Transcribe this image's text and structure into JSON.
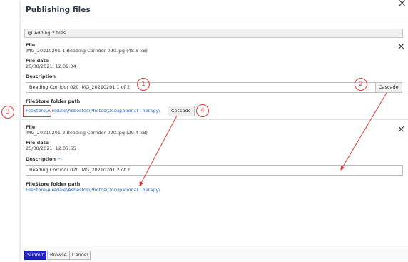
{
  "dialog": {
    "title": "Publishing files",
    "close_glyph": "×"
  },
  "info": {
    "icon": "info-icon",
    "text": "Adding 2 files."
  },
  "files": [
    {
      "file_label": "File",
      "file_name": "IMG_20210201-1 Beading Corridor 020.jpg (48.8 kB)",
      "date_label": "File date",
      "date_value": "25/08/2021, 12:09:04",
      "desc_label": "Description",
      "desc_value": "Beading Corridor 020 IMG_20210201 1 of 2",
      "cascade_label": "Cascade",
      "path_label": "FileStore folder path",
      "path_root": "FileStore\\",
      "path_rest": "Airedale\\Asbestos\\Photos\\Occupational Therapy\\",
      "path_cascade_label": "Cascade",
      "remove_glyph": "×"
    },
    {
      "file_label": "File",
      "file_name": "IMG_20210201-2 Beading Corridor 020.jpg (29.4 kB)",
      "date_label": "File date",
      "date_value": "25/08/2021, 12:07:55",
      "desc_label": "Description",
      "desc_required": "(*)",
      "desc_value": "Beading Corridor 020 IMG_20210201 2 of 2",
      "path_label": "FileStore folder path",
      "path_value": "FileStore\\Airedale\\Asbestos\\Photos\\Occupational Therapy\\",
      "remove_glyph": "×"
    }
  ],
  "footer": {
    "submit": "Submit",
    "browse": "Browse",
    "cancel": "Cancel"
  },
  "callouts": [
    "1",
    "2",
    "3",
    "4"
  ],
  "colors": {
    "accent": "#2b66c5",
    "annotation": "#e53935",
    "submit": "#2222cc"
  }
}
